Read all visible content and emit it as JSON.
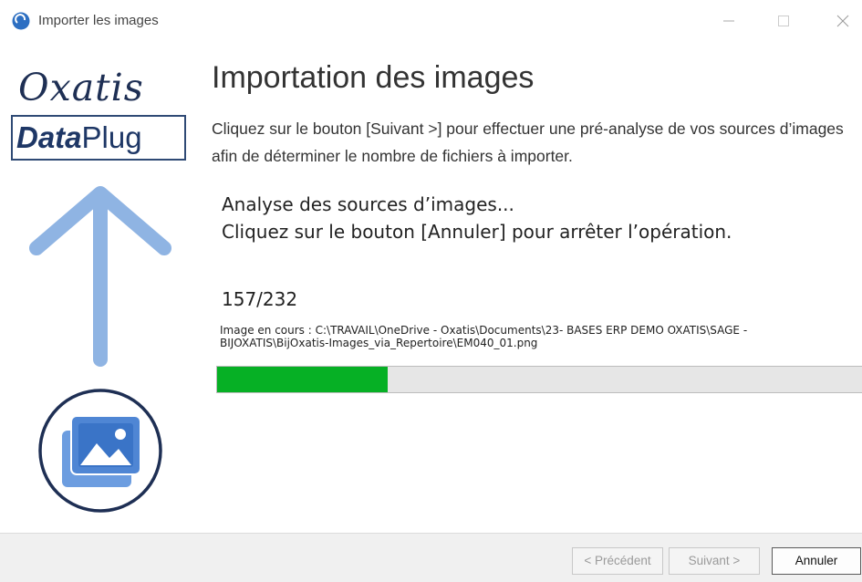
{
  "window": {
    "title": "Importer les images",
    "app_icon": "oxatis-app-icon"
  },
  "logo": {
    "brand": "Oxatis",
    "product_bold": "Data",
    "product_rest": "Plug"
  },
  "main": {
    "heading": "Importation des images",
    "instruction": "Cliquez sur le bouton [Suivant >] pour effectuer une pré-analyse de vos sources d’images afin de déterminer le nombre de fichiers à importer.",
    "status_line_1": "Analyse des sources d’images...",
    "status_line_2": "Cliquez sur le bouton [Annuler] pour arrêter l’opération.",
    "counter": "157/232",
    "current_file": "Image en cours : C:\\TRAVAIL\\OneDrive - Oxatis\\Documents\\23- BASES ERP DEMO OXATIS\\SAGE - BIJOXATIS\\BijOxatis-Images_via_Repertoire\\EM040_01.png",
    "progress_fraction": 0.265
  },
  "footer": {
    "prev_label": "< Précédent",
    "next_label": "Suivant >",
    "cancel_label": "Annuler"
  },
  "colors": {
    "progress_fill": "#06b025",
    "arrow": "#8fb4e3",
    "image_icon": "#4f86d4",
    "logo_text": "#1e2f54"
  }
}
